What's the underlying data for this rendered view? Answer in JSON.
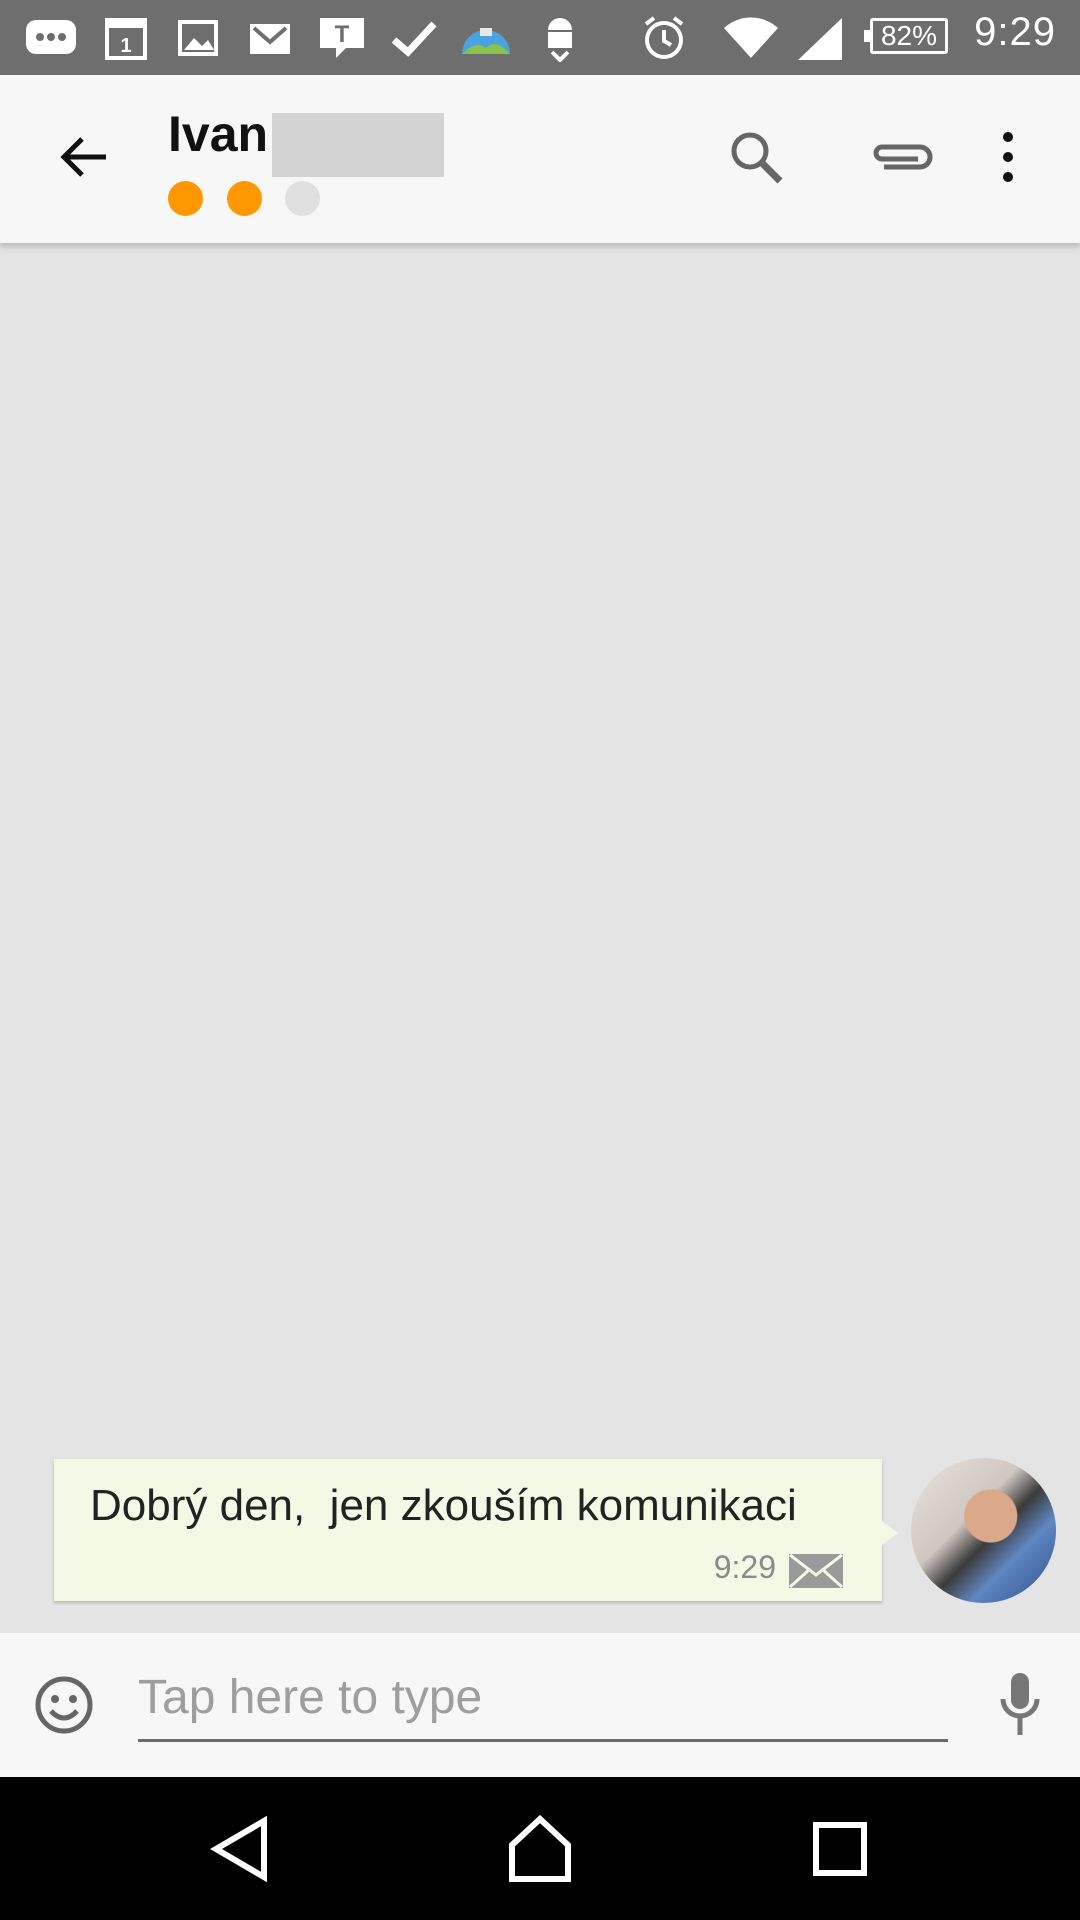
{
  "status_bar": {
    "time": "9:29",
    "battery": "82%",
    "icons": [
      "message-icon",
      "calendar-icon",
      "gallery-icon",
      "gmail-icon",
      "t-app-icon",
      "check-icon",
      "map-app-icon",
      "android-update-icon",
      "alarm-icon",
      "wifi-icon",
      "signal-icon"
    ]
  },
  "header": {
    "contact_name": "Ivan",
    "status_dots": [
      "#ff9800",
      "#ff9800",
      "#e0e0e0"
    ]
  },
  "messages": [
    {
      "text": "Dobrý den,  jen zkouším komunikaci",
      "time": "9:29",
      "status_icon": "envelope-icon",
      "bubble_color": "#f3f9e4"
    }
  ],
  "composer": {
    "placeholder": "Tap here to type"
  },
  "colors": {
    "accent": "#ff9800",
    "status_bar": "#6e6e6e",
    "app_bar": "#f7f7f7",
    "chat_background": "#e4e4e4"
  }
}
